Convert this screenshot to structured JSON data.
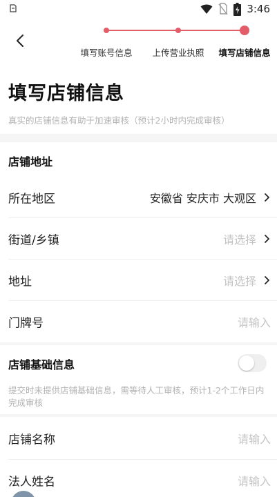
{
  "statusbar": {
    "time": "3:46",
    "icons": [
      "notification-icon",
      "wifi-icon",
      "no-sim-icon",
      "battery-icon"
    ]
  },
  "header": {
    "back_icon": "chevron-left-icon",
    "steps": [
      {
        "label": "填写账号信息",
        "state": "done"
      },
      {
        "label": "上传营业执照",
        "state": "done"
      },
      {
        "label": "填写店铺信息",
        "state": "active"
      }
    ],
    "accent_color": "#e35d68"
  },
  "page": {
    "title": "填写店铺信息",
    "subtitle": "真实的店铺信息有助于加速审核（预计2小时内完成审核）"
  },
  "address_section": {
    "title": "店铺地址",
    "rows": [
      {
        "label": "所在地区",
        "value": "安徽省 安庆市 大观区",
        "kind": "select"
      },
      {
        "label": "街道/乡镇",
        "placeholder": "请选择",
        "kind": "select"
      },
      {
        "label": "地址",
        "placeholder": "请选择",
        "kind": "select"
      },
      {
        "label": "门牌号",
        "placeholder": "请输入",
        "kind": "input"
      }
    ]
  },
  "basic_section": {
    "title": "店铺基础信息",
    "toggle_on": false,
    "note": "提交时未提供店铺基础信息，需等待人工审核，预计1-2个工作日内完成审核",
    "rows": [
      {
        "label": "店铺名称",
        "placeholder": "请输入",
        "kind": "input"
      },
      {
        "label": "法人姓名",
        "placeholder": "请输入",
        "kind": "input"
      }
    ]
  }
}
